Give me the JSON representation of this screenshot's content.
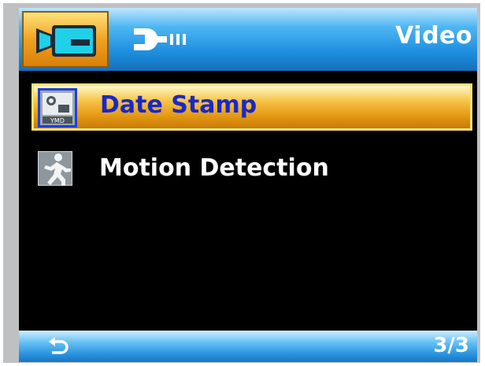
{
  "header": {
    "mode_title": "Video",
    "tabs": [
      {
        "icon": "video-camera-icon",
        "selected": true
      },
      {
        "icon": "wrench-icon",
        "selected": false
      }
    ]
  },
  "menu": {
    "items": [
      {
        "label": "Date Stamp",
        "icon": "date-stamp-icon",
        "selected": true
      },
      {
        "label": "Motion Detection",
        "icon": "motion-detection-icon",
        "selected": false
      }
    ]
  },
  "footer": {
    "back_icon": "back-arrow-icon",
    "page_indicator": "3/3"
  },
  "colors": {
    "selection": "#e49913",
    "selected_text": "#1928c8",
    "bar_blue": "#1d8fe0"
  }
}
